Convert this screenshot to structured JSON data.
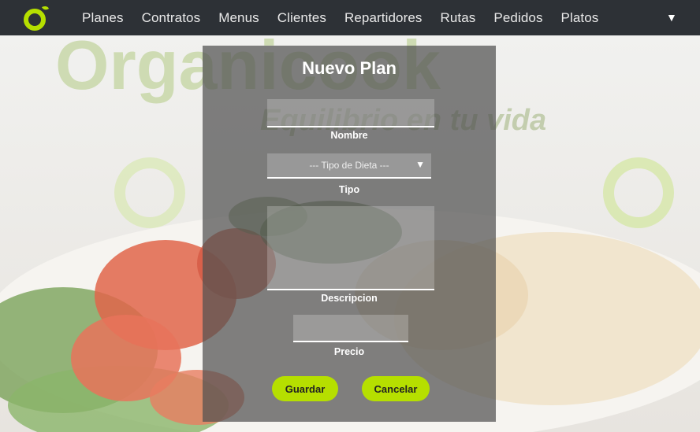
{
  "brand": {
    "logo": "organicook-logo",
    "bg_wordmark": "Organicook",
    "bg_tagline": "Equilibrio en tu vida"
  },
  "nav": {
    "items": [
      "Planes",
      "Contratos",
      "Menus",
      "Clientes",
      "Repartidores",
      "Rutas",
      "Pedidos",
      "Platos"
    ],
    "menu_caret": "▼"
  },
  "modal": {
    "title": "Nuevo Plan",
    "nombre": {
      "label": "Nombre",
      "value": ""
    },
    "tipo": {
      "label": "Tipo",
      "selected": "--- Tipo de Dieta ---",
      "arrow": "▼"
    },
    "descripcion": {
      "label": "Descripcion",
      "value": ""
    },
    "precio": {
      "label": "Precio",
      "value": ""
    },
    "buttons": {
      "save": "Guardar",
      "cancel": "Cancelar"
    }
  },
  "colors": {
    "topbar": "#2d3136",
    "accent": "#b6df00",
    "modal_bg": "rgba(80,80,80,0.72)"
  }
}
